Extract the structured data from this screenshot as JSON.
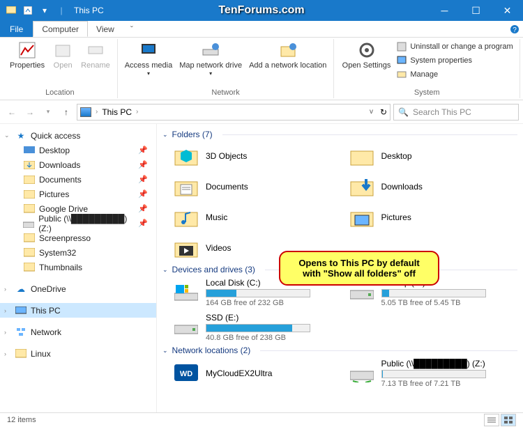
{
  "watermark": "TenForums.com",
  "titlebar": {
    "title": "This PC"
  },
  "menubar": {
    "file": "File",
    "tabs": [
      "Computer",
      "View"
    ],
    "active": 0
  },
  "ribbon": {
    "location": {
      "label": "Location",
      "properties": "Properties",
      "open": "Open",
      "rename": "Rename"
    },
    "network": {
      "label": "Network",
      "access": "Access media",
      "map": "Map network drive",
      "add": "Add a network location"
    },
    "system": {
      "label": "System",
      "open_settings": "Open Settings",
      "uninstall": "Uninstall or change a program",
      "sysprops": "System properties",
      "manage": "Manage"
    }
  },
  "address": {
    "path": "This PC"
  },
  "search": {
    "placeholder": "Search This PC"
  },
  "sidebar": {
    "quick": "Quick access",
    "items": [
      "Desktop",
      "Downloads",
      "Documents",
      "Pictures",
      "Google Drive",
      "Public (\\\\█████████) (Z:)",
      "Screenpresso",
      "System32",
      "Thumbnails"
    ],
    "onedrive": "OneDrive",
    "thispc": "This PC",
    "network": "Network",
    "linux": "Linux"
  },
  "content": {
    "folders_hdr": "Folders (7)",
    "folders": [
      "3D Objects",
      "Desktop",
      "Documents",
      "Downloads",
      "Music",
      "Pictures",
      "Videos"
    ],
    "drives_hdr": "Devices and drives (3)",
    "drives": [
      {
        "name": "Local Disk (C:)",
        "free": "164 GB free of 232 GB",
        "pct": 29
      },
      {
        "name": "Backup (D:)",
        "free": "5.05 TB free of 5.45 TB",
        "pct": 7
      },
      {
        "name": "SSD (E:)",
        "free": "40.8 GB free of 238 GB",
        "pct": 83
      }
    ],
    "netloc_hdr": "Network locations (2)",
    "netlocs": [
      {
        "name": "MyCloudEX2Ultra",
        "free": ""
      },
      {
        "name": "Public (\\\\█████████) (Z:)",
        "free": "7.13 TB free of 7.21 TB",
        "pct": 1
      }
    ]
  },
  "callout": "Opens to This PC by default with \"Show all folders\" off",
  "status": {
    "items": "12 items"
  }
}
